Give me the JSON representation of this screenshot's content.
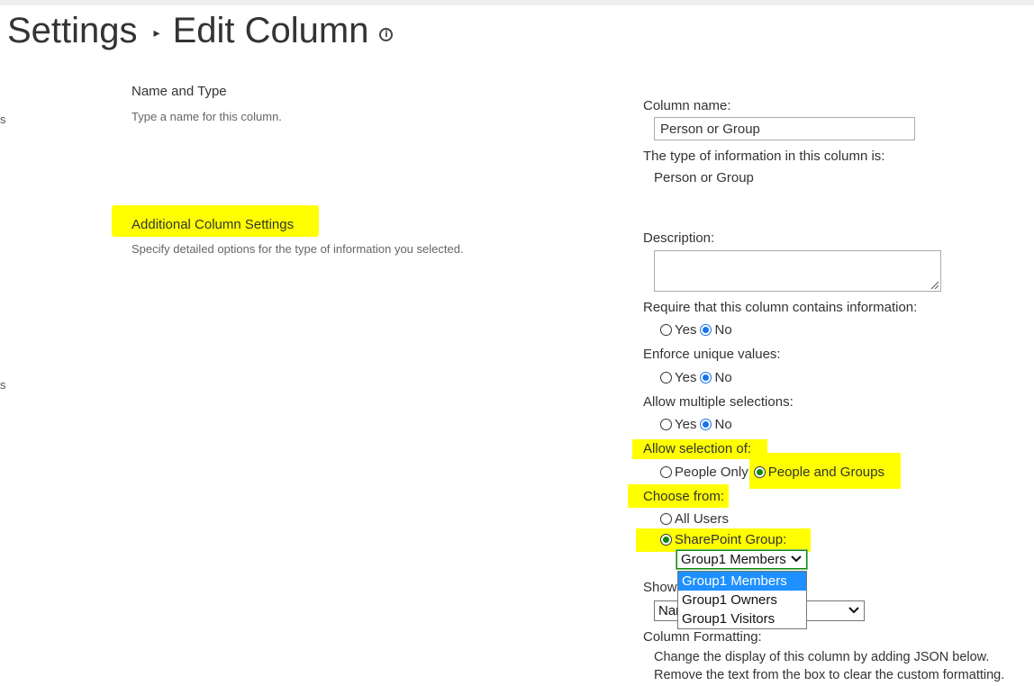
{
  "breadcrumb": {
    "parent": "Settings",
    "separator": "▸",
    "current": "Edit Column",
    "info_icon_glyph": "i"
  },
  "left_edge_fragments": [
    "s",
    "s"
  ],
  "sections": {
    "name_and_type": {
      "heading": "Name and Type",
      "description": "Type a name for this column."
    },
    "additional": {
      "heading": "Additional Column Settings",
      "description": "Specify detailed options for the type of information you selected."
    }
  },
  "form": {
    "column_name_label": "Column name:",
    "column_name_value": "Person or Group",
    "type_label": "The type of information in this column is:",
    "type_value": "Person or Group",
    "description_label": "Description:",
    "description_value": "",
    "require": {
      "label": "Require that this column contains information:",
      "yes": "Yes",
      "no": "No",
      "selected": "No"
    },
    "unique": {
      "label": "Enforce unique values:",
      "yes": "Yes",
      "no": "No",
      "selected": "No"
    },
    "multiple": {
      "label": "Allow multiple selections:",
      "yes": "Yes",
      "no": "No",
      "selected": "No"
    },
    "allow_selection": {
      "label": "Allow selection of:",
      "people_only": "People Only",
      "people_groups": "People and Groups",
      "selected": "People and Groups"
    },
    "choose_from": {
      "label": "Choose from:",
      "all_users": "All Users",
      "sp_group": "SharePoint Group:",
      "selected": "SharePoint Group:"
    },
    "group_select": {
      "value": "Group1 Members",
      "options": [
        "Group1 Members",
        "Group1 Owners",
        "Group1 Visitors"
      ],
      "highlighted": "Group1 Members"
    },
    "show_field": {
      "label_visible": "Show",
      "value_visible": "Nar"
    },
    "column_formatting": {
      "label": "Column Formatting:",
      "line1": "Change the display of this column by adding JSON below.",
      "line2": "Remove the text from the box to clear the custom formatting."
    }
  },
  "colors": {
    "highlight": "#ffff00",
    "selected_option": "#1e90ff",
    "radio_blue": "#1a73e8",
    "radio_green": "#0a8a0a"
  }
}
